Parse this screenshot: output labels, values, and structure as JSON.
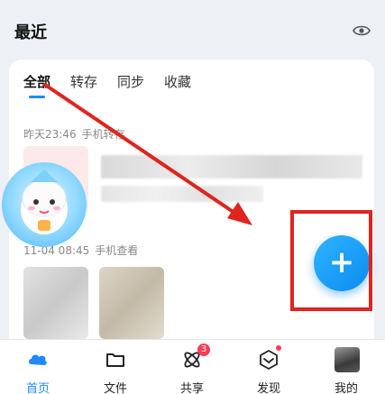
{
  "section": {
    "title": "最近",
    "eye_icon": "eye-icon"
  },
  "tabs": [
    {
      "label": "全部",
      "active": true
    },
    {
      "label": "转存",
      "active": false
    },
    {
      "label": "同步",
      "active": false
    },
    {
      "label": "收藏",
      "active": false
    }
  ],
  "groups": [
    {
      "time": "昨天23:46",
      "source": "手机转存"
    },
    {
      "time": "11-04 08:45",
      "source": "手机查看"
    }
  ],
  "fab": {
    "symbol": "+"
  },
  "tabbar": {
    "items": [
      {
        "label": "首页",
        "icon": "cloud-home-icon",
        "active": true
      },
      {
        "label": "文件",
        "icon": "folder-icon",
        "active": false
      },
      {
        "label": "共享",
        "icon": "share-atom-icon",
        "active": false,
        "badge": "3"
      },
      {
        "label": "发现",
        "icon": "discover-cube-icon",
        "active": false,
        "dot": true
      },
      {
        "label": "我的",
        "icon": "avatar-icon",
        "active": false
      }
    ]
  },
  "colors": {
    "accent": "#1e88ff",
    "annotation": "#e0241e",
    "badge": "#ff3b55"
  }
}
